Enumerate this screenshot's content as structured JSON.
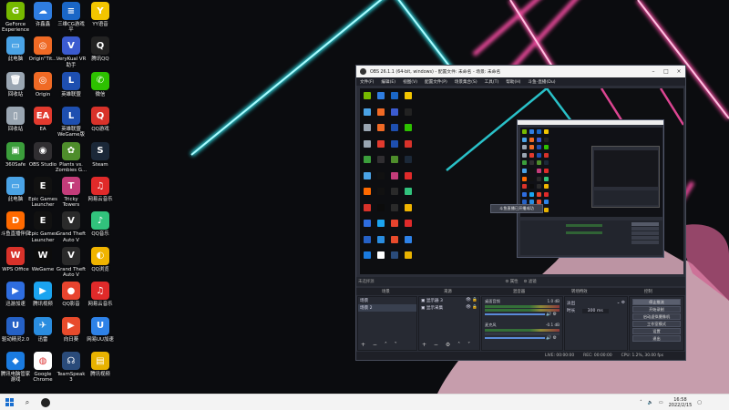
{
  "desktop": {
    "icons": [
      {
        "label": "GeForce\nExperience",
        "color": "#76b900",
        "glyph": "G",
        "icon": "geforce-icon"
      },
      {
        "label": "许鑫鑫",
        "color": "#2f7de1",
        "glyph": "☁",
        "icon": "chat-icon"
      },
      {
        "label": "三维CG游戏\n平",
        "color": "#1a66c6",
        "glyph": "≡",
        "icon": "game-icon"
      },
      {
        "label": "YY语音",
        "color": "#f2c500",
        "glyph": "Y",
        "icon": "yy-icon"
      },
      {
        "label": "此电脑",
        "color": "#4aa3e6",
        "glyph": "▭",
        "icon": "computer-icon"
      },
      {
        "label": "Origin\"Tit...",
        "color": "#f06a25",
        "glyph": "◎",
        "icon": "origin-icon"
      },
      {
        "label": "VeryKual VR\n助手",
        "color": "#3b5bd0",
        "glyph": "V",
        "icon": "vr-icon"
      },
      {
        "label": "腾讯QQ",
        "color": "#222",
        "glyph": "Q",
        "icon": "qq-icon"
      },
      {
        "label": "回收站",
        "color": "#9aa6b2",
        "glyph": "🗑",
        "icon": "recycle-bin-icon"
      },
      {
        "label": "Origin",
        "color": "#f06a25",
        "glyph": "◎",
        "icon": "origin-icon"
      },
      {
        "label": "英雄联盟",
        "color": "#1e4fb0",
        "glyph": "L",
        "icon": "lol-icon"
      },
      {
        "label": "微信",
        "color": "#2dc100",
        "glyph": "✆",
        "icon": "wechat-icon"
      },
      {
        "label": "回收站",
        "color": "#9aa6b2",
        "glyph": "▯",
        "icon": "bin-icon"
      },
      {
        "label": "EA",
        "color": "#e23a2e",
        "glyph": "EA",
        "icon": "ea-icon"
      },
      {
        "label": "英雄联盟\nWeGame版",
        "color": "#1e4fb0",
        "glyph": "L",
        "icon": "lol-wegame-icon"
      },
      {
        "label": "QQ游戏",
        "color": "#d8322a",
        "glyph": "Q",
        "icon": "qqgame-icon"
      },
      {
        "label": "360Safe",
        "color": "#3b9e3b",
        "glyph": "▣",
        "icon": "safe-icon"
      },
      {
        "label": "OBS Studio",
        "color": "#302e31",
        "glyph": "◉",
        "icon": "obs-icon"
      },
      {
        "label": "Plants vs.\nZombies G...",
        "color": "#4e8d2b",
        "glyph": "✿",
        "icon": "pvz-icon"
      },
      {
        "label": "Steam",
        "color": "#1b2838",
        "glyph": "S",
        "icon": "steam-icon"
      },
      {
        "label": "此电脑",
        "color": "#4aa3e6",
        "glyph": "▭",
        "icon": "pc-icon"
      },
      {
        "label": "Epic Games\nLauncher",
        "color": "#111",
        "glyph": "E",
        "icon": "epic-icon"
      },
      {
        "label": "Tricky\nTowers",
        "color": "#c43c7a",
        "glyph": "T",
        "icon": "tricky-towers-icon"
      },
      {
        "label": "网易云音乐",
        "color": "#e02a2a",
        "glyph": "♫",
        "icon": "music-icon"
      },
      {
        "label": "斗鱼直播伴侣",
        "color": "#ff6a00",
        "glyph": "D",
        "icon": "douyu-icon"
      },
      {
        "label": "Epic Games\nLauncher",
        "color": "#111",
        "glyph": "E",
        "icon": "epic2-icon"
      },
      {
        "label": "Grand Theft\nAuto V",
        "color": "#2a2a2a",
        "glyph": "V",
        "icon": "gta-icon"
      },
      {
        "label": "QQ音乐",
        "color": "#31c27c",
        "glyph": "♪",
        "icon": "qqmusic-icon"
      },
      {
        "label": "WPS Office",
        "color": "#d8322a",
        "glyph": "W",
        "icon": "wps-icon"
      },
      {
        "label": "WeGame",
        "color": "#0c0c0c",
        "glyph": "W",
        "icon": "wegame-icon"
      },
      {
        "label": "Grand Theft\nAuto V",
        "color": "#2a2a2a",
        "glyph": "V",
        "icon": "gta2-icon"
      },
      {
        "label": "QQ浏览",
        "color": "#f0b400",
        "glyph": "◐",
        "icon": "qqbrowser-icon"
      },
      {
        "label": "迅游加速",
        "color": "#2e6de0",
        "glyph": "▶",
        "icon": "accelerator-icon"
      },
      {
        "label": "腾讯视频",
        "color": "#1ba4f0",
        "glyph": "▶",
        "icon": "video-icon"
      },
      {
        "label": "QQ影音",
        "color": "#e8442e",
        "glyph": "●",
        "icon": "qqplayer-icon"
      },
      {
        "label": "网易云音乐",
        "color": "#e02a2a",
        "glyph": "♫",
        "icon": "music2-icon"
      },
      {
        "label": "驱动精灵2.0",
        "color": "#2561c6",
        "glyph": "U",
        "icon": "driver-icon"
      },
      {
        "label": "迅雷",
        "color": "#2a8de0",
        "glyph": "✈",
        "icon": "xunlei-icon"
      },
      {
        "label": "向日葵",
        "color": "#e84b2c",
        "glyph": "▶",
        "icon": "sunflower-icon"
      },
      {
        "label": "网易UU加速",
        "color": "#2e82e8",
        "glyph": "U",
        "icon": "uu-icon"
      },
      {
        "label": "腾讯电脑管家\n游戏",
        "color": "#1a7be0",
        "glyph": "◆",
        "icon": "pcmgr-icon"
      },
      {
        "label": "Google\nChrome",
        "color": "#ffffff",
        "glyph": "◍",
        "icon": "chrome-icon"
      },
      {
        "label": "TeamSpeak\n3",
        "color": "#2a4b7a",
        "glyph": "☊",
        "icon": "teamspeak-icon"
      },
      {
        "label": "腾讯视频",
        "color": "#e8b200",
        "glyph": "▤",
        "icon": "folder-icon"
      }
    ]
  },
  "obs": {
    "title": "OBS 26.1.1 (64-bit, windows) - 配置文件: 未命名 - 场景: 未命名",
    "menu": [
      "文件(F)",
      "编辑(E)",
      "视图(V)",
      "配置文件(P)",
      "场景集合(S)",
      "工具(T)",
      "帮助(H)",
      "斗鱼-直播(Du)"
    ],
    "scene_bar": [
      "⚙ 属性",
      "⚙ 滤镜"
    ],
    "status_line": "未选择源",
    "dock_titles": {
      "scenes": "场景",
      "sources": "来源",
      "mixer": "混音器",
      "transitions": "转场特效",
      "controls": "控制"
    },
    "scenes": [
      "场景",
      "场景 2"
    ],
    "sources": [
      "显示器 3",
      "显示采集"
    ],
    "mixer": [
      {
        "name": "桌面音频",
        "level": "1.0 dB",
        "active": true
      },
      {
        "name": "麦克风",
        "level": "-0.1 dB",
        "active": false
      }
    ],
    "transition": {
      "type": "淡出",
      "duration_label": "时长",
      "duration": "300 ms"
    },
    "controls": [
      "停止推流",
      "开始录制",
      "启动虚拟摄像机",
      "工作室模式",
      "设置",
      "退出"
    ],
    "status": {
      "live": "LIVE: 00:00:00",
      "rec": "REC: 00:00:00",
      "cpu": "CPU: 1.2%, 30.00 fps"
    },
    "preview_toast": "斗鱼直播已开播成功"
  },
  "taskbar": {
    "time": "16:58",
    "date": "2022/2/15"
  }
}
